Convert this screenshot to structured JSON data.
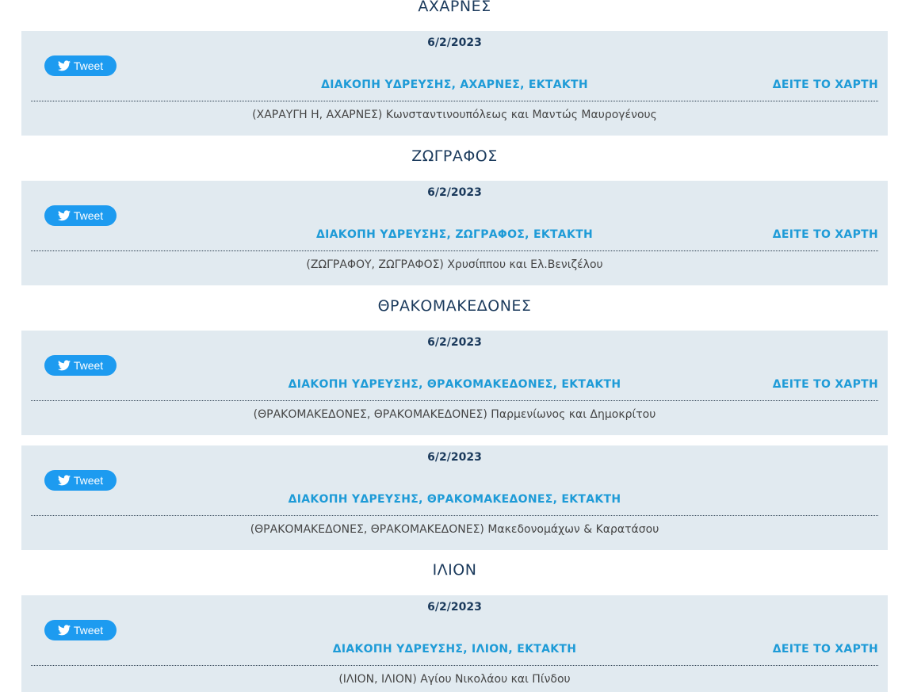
{
  "areas": [
    {
      "name": "ΑΧΑΡΝΕΣ",
      "notices": [
        {
          "date": "6/2/2023",
          "tweet_label": "Tweet",
          "title": "ΔΙΑΚΟΠΗ ΥΔΡΕΥΣΗΣ, ΑΧΑΡΝΕΣ, ΕΚΤΑΚΤΗ",
          "map_label": "ΔΕΙΤΕ ΤΟ ΧΑΡΤΗ",
          "details": "(ΧΑΡΑΥΓΗ Η, ΑΧΑΡΝΕΣ) Κωνσταντινουπόλεως και Μαντώς Μαυρογένους"
        }
      ]
    },
    {
      "name": "ΖΩΓΡΑΦΟΣ",
      "notices": [
        {
          "date": "6/2/2023",
          "tweet_label": "Tweet",
          "title": "ΔΙΑΚΟΠΗ ΥΔΡΕΥΣΗΣ, ΖΩΓΡΑΦΟΣ, ΕΚΤΑΚΤΗ",
          "map_label": "ΔΕΙΤΕ ΤΟ ΧΑΡΤΗ",
          "details": "(ΖΩΓΡΑΦΟΥ, ΖΩΓΡΑΦΟΣ) Χρυσίππου και Ελ.Βενιζέλου"
        }
      ]
    },
    {
      "name": "ΘΡΑΚΟΜΑΚΕΔΟΝΕΣ",
      "notices": [
        {
          "date": "6/2/2023",
          "tweet_label": "Tweet",
          "title": "ΔΙΑΚΟΠΗ ΥΔΡΕΥΣΗΣ, ΘΡΑΚΟΜΑΚΕΔΟΝΕΣ, ΕΚΤΑΚΤΗ",
          "map_label": "ΔΕΙΤΕ ΤΟ ΧΑΡΤΗ",
          "details": "(ΘΡΑΚΟΜΑΚΕΔΟΝΕΣ, ΘΡΑΚΟΜΑΚΕΔΟΝΕΣ) Παρμενίωνος και Δημοκρίτου"
        },
        {
          "date": "6/2/2023",
          "tweet_label": "Tweet",
          "title": "ΔΙΑΚΟΠΗ ΥΔΡΕΥΣΗΣ, ΘΡΑΚΟΜΑΚΕΔΟΝΕΣ, ΕΚΤΑΚΤΗ",
          "details": "(ΘΡΑΚΟΜΑΚΕΔΟΝΕΣ, ΘΡΑΚΟΜΑΚΕΔΟΝΕΣ) Μακεδονομάχων & Καρατάσου"
        }
      ]
    },
    {
      "name": "ΙΛΙΟΝ",
      "notices": [
        {
          "date": "6/2/2023",
          "tweet_label": "Tweet",
          "title": "ΔΙΑΚΟΠΗ ΥΔΡΕΥΣΗΣ, ΙΛΙΟΝ, ΕΚΤΑΚΤΗ",
          "map_label": "ΔΕΙΤΕ ΤΟ ΧΑΡΤΗ",
          "details": "(ΙΛΙΟΝ, ΙΛΙΟΝ) Αγίου Νικολάου και Πίνδου"
        }
      ]
    }
  ],
  "colors": {
    "heading": "#1b3a5c",
    "link": "#1e9bd7",
    "card_bg": "#e1eaf0",
    "tweet_button": "#1d9bf0"
  },
  "icons": {
    "tweet": "twitter-bird-icon"
  }
}
